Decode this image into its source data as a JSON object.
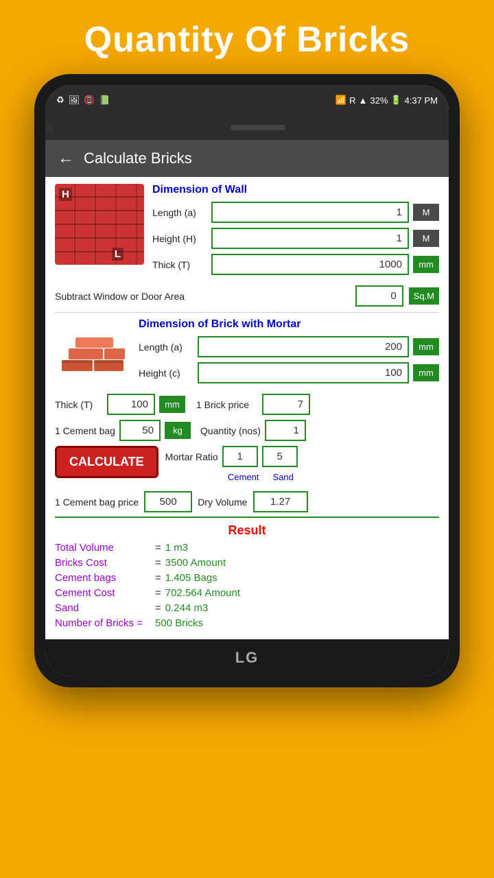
{
  "page": {
    "title": "Quantity Of Bricks",
    "toolbar_title": "Calculate Bricks",
    "back_label": "←"
  },
  "status_bar": {
    "battery": "32%",
    "time": "4:37 PM",
    "signal": "R"
  },
  "wall": {
    "section_label": "Dimension of Wall",
    "length_label": "Length (a)",
    "length_value": "1",
    "length_unit": "M",
    "height_label": "Height (H)",
    "height_value": "1",
    "height_unit": "M",
    "thick_label": "Thick (T)",
    "thick_value": "1000",
    "thick_unit": "mm",
    "subtract_label": "Subtract Window or Door Area",
    "subtract_value": "0",
    "subtract_unit": "Sq.M"
  },
  "brick": {
    "section_label": "Dimension of Brick with Mortar",
    "length_label": "Length (a)",
    "length_value": "200",
    "length_unit": "mm",
    "height_label": "Height (c)",
    "height_value": "100",
    "height_unit": "mm"
  },
  "thick": {
    "label": "Thick (T)",
    "value": "100",
    "unit": "mm"
  },
  "brick_price": {
    "label": "1 Brick price",
    "value": "7"
  },
  "cement_bag": {
    "label": "1 Cement bag",
    "value": "50",
    "unit": "kg"
  },
  "quantity": {
    "label": "Quantity (nos)",
    "value": "1"
  },
  "calculate_btn": "CALCULATE",
  "mortar_ratio": {
    "label": "Mortar Ratio",
    "cement_value": "1",
    "sand_value": "5",
    "cement_label": "Cement",
    "sand_label": "Sand"
  },
  "cement_price": {
    "label": "1 Cement bag price",
    "value": "500"
  },
  "dry_volume": {
    "label": "Dry Volume",
    "value": "1.27"
  },
  "result": {
    "title": "Result",
    "total_volume_key": "Total  Volume",
    "total_volume_val": "1 m3",
    "bricks_cost_key": "Bricks Cost",
    "bricks_cost_val": "3500 Amount",
    "cement_bags_key": "Cement bags",
    "cement_bags_val": "1.405 Bags",
    "cement_cost_key": "Cement Cost",
    "cement_cost_val": "702.564 Amount",
    "sand_key": "Sand",
    "sand_val": "0.244 m3",
    "num_bricks_key": "Number of Bricks =",
    "num_bricks_val": "500 Bricks"
  },
  "bottom": {
    "logo": "LG"
  },
  "brick_image": {
    "label_h": "H",
    "label_l": "L"
  }
}
